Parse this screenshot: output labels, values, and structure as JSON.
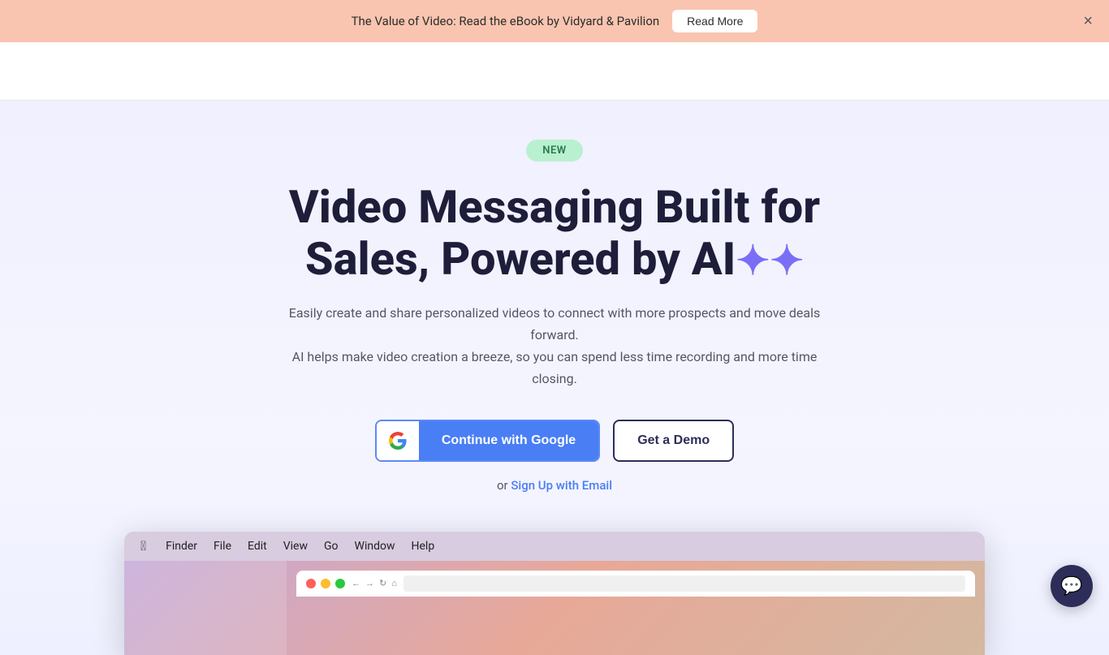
{
  "banner": {
    "text": "The Value of Video: Read the eBook by Vidyard & Pavilion",
    "read_more_label": "Read More",
    "close_label": "×"
  },
  "navbar": {},
  "hero": {
    "badge_label": "NEW",
    "headline_line1": "Video Messaging Built for",
    "headline_line2": "Sales, Powered by AI",
    "sparkle": "✦✦",
    "subheadline_line1": "Easily create and share personalized videos to connect with more prospects and move deals forward.",
    "subheadline_line2": "AI helps make video creation a breeze, so you can spend less time recording and more time closing.",
    "google_btn_label": "Continue with Google",
    "demo_btn_label": "Get a Demo",
    "signup_alt_prefix": "or",
    "signup_alt_link": "Sign Up with Email"
  },
  "mac_preview": {
    "menu_items": [
      "Finder",
      "File",
      "Edit",
      "View",
      "Go",
      "Window",
      "Help"
    ]
  },
  "chat_widget": {
    "icon": "💬"
  }
}
